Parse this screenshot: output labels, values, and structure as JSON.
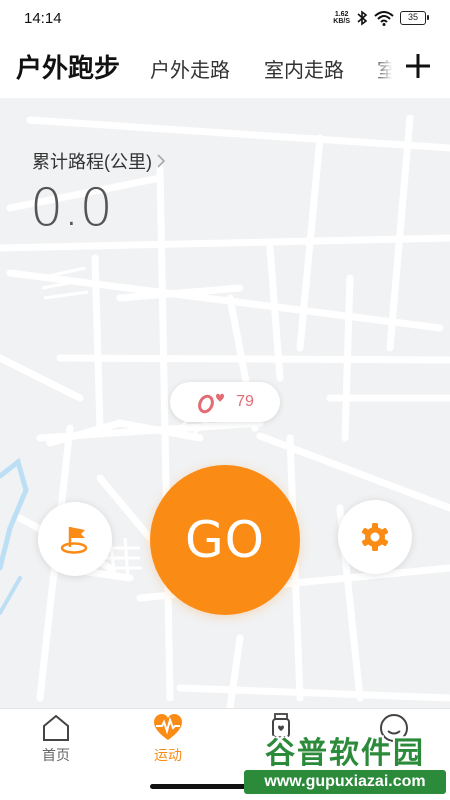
{
  "status_bar": {
    "time": "14:14",
    "net_speed_value": "1.62",
    "net_speed_unit": "KB/S",
    "battery": "35",
    "icons": [
      "bluetooth-icon",
      "wifi-icon",
      "battery-icon"
    ]
  },
  "tabs": {
    "items": [
      {
        "label": "户外跑步",
        "active": true
      },
      {
        "label": "户外走路",
        "active": false
      },
      {
        "label": "室内走路",
        "active": false
      },
      {
        "label": "室",
        "active": false
      }
    ],
    "add_icon": "plus-icon"
  },
  "stats": {
    "distance_label": "累计路程(公里)",
    "distance_value": "0.0"
  },
  "heart_rate": {
    "value": "79",
    "icon": "heart-band-icon"
  },
  "actions": {
    "go_label": "GO",
    "flag_icon": "flag-icon",
    "settings_icon": "gear-icon"
  },
  "bottom_nav": {
    "items": [
      {
        "label": "首页",
        "icon": "home-icon",
        "active": false
      },
      {
        "label": "运动",
        "icon": "heart-pulse-icon",
        "active": true
      },
      {
        "label": "",
        "icon": "watch-icon",
        "active": false
      },
      {
        "label": "",
        "icon": "profile-icon",
        "active": false
      }
    ]
  },
  "watermark": {
    "title": "谷普软件园",
    "url": "www.gupuxiazai.com"
  },
  "colors": {
    "accent": "#fa8c16",
    "heart": "#e36b73",
    "map_bg": "#f1f2f3",
    "map_road": "#ffffff",
    "river": "#bcdff6",
    "watermark_green": "#2c8b3a"
  }
}
